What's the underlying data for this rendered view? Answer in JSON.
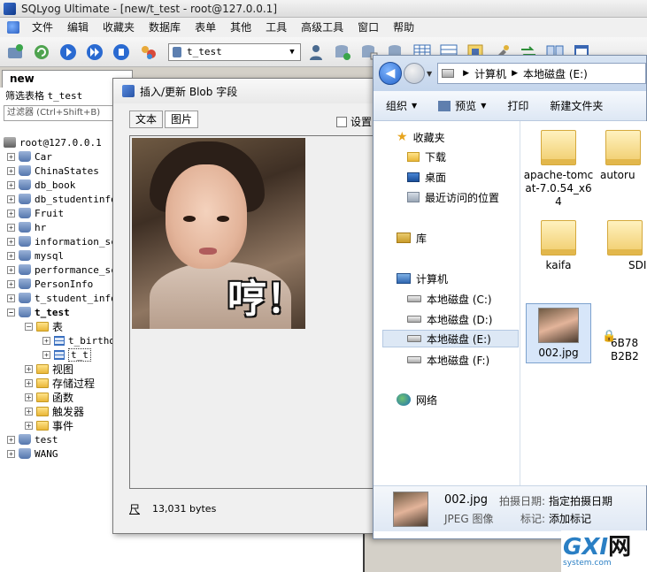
{
  "app": {
    "title": "SQLyog Ultimate - [new/t_test - root@127.0.0.1]",
    "menu": [
      "文件",
      "编辑",
      "收藏夹",
      "数据库",
      "表单",
      "其他",
      "工具",
      "高级工具",
      "窗口",
      "帮助"
    ],
    "db_selector": "t_test",
    "query_tab": "new"
  },
  "object_browser": {
    "filter_label": "筛选表格",
    "filter_table": "t_test",
    "filter_placeholder": "过滤器 (Ctrl+Shift+B)",
    "server": "root@127.0.0.1",
    "databases": [
      "Car",
      "ChinaStates",
      "db_book",
      "db_studentinfo",
      "Fruit",
      "hr",
      "information_schema",
      "mysql",
      "performance_schema",
      "PersonInfo",
      "t_student_info"
    ],
    "open_db": "t_test",
    "tables_folder": "表",
    "tables": [
      "t_birthday",
      "t_t"
    ],
    "folders": [
      "视图",
      "存储过程",
      "函数",
      "触发器",
      "事件"
    ],
    "after_dbs": [
      "test",
      "WANG"
    ]
  },
  "blob_dialog": {
    "title": "插入/更新 Blob 字段",
    "tab_text": "文本",
    "tab_image": "图片",
    "settings_label": "设置",
    "image_caption": "哼！",
    "size": "13,031 bytes",
    "size_icon": "尺"
  },
  "explorer": {
    "path": [
      "计算机",
      "本地磁盘 (E:)"
    ],
    "commands": {
      "organize": "组织",
      "preview": "预览",
      "print": "打印",
      "new_folder": "新建文件夹"
    },
    "nav": {
      "favorites": "收藏夹",
      "downloads": "下载",
      "desktop": "桌面",
      "recent": "最近访问的位置",
      "libraries": "库",
      "computer": "计算机",
      "drive_c": "本地磁盘 (C:)",
      "drive_d": "本地磁盘 (D:)",
      "drive_e": "本地磁盘 (E:)",
      "drive_f": "本地磁盘 (F:)",
      "network": "网络"
    },
    "files": {
      "f1": "apache-tomcat-7.0.54_x64",
      "f2": "autoru",
      "f3": "kaifa",
      "f4": "SDI",
      "f5": "002.jpg",
      "f6": "6B78B2B2"
    },
    "details": {
      "name": "002.jpg",
      "type": "JPEG 图像",
      "date_key": "拍摄日期:",
      "date_val": "指定拍摄日期",
      "tag_key": "标记:",
      "tag_val": "添加标记"
    }
  },
  "watermark": {
    "main": "GXI",
    "cjk": "网",
    "sub": "system.com"
  }
}
